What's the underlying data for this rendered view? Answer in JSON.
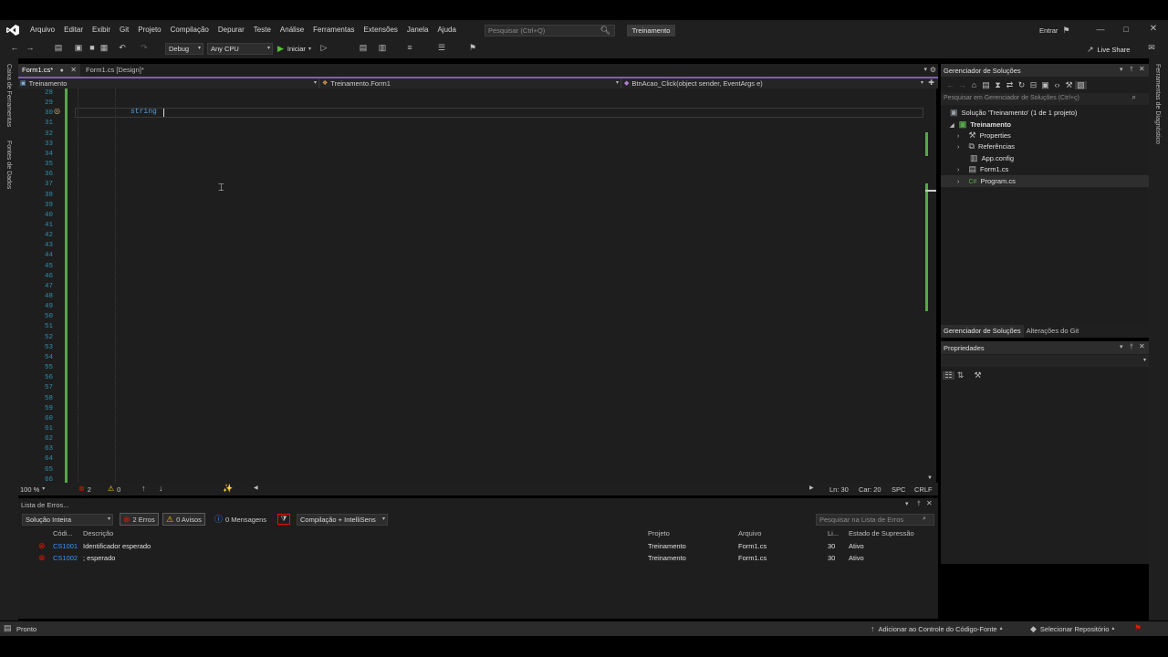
{
  "menu": {
    "items": [
      "Arquivo",
      "Editar",
      "Exibir",
      "Git",
      "Projeto",
      "Compilação",
      "Depurar",
      "Teste",
      "Análise",
      "Ferramentas",
      "Extensões",
      "Janela",
      "Ajuda"
    ],
    "search_placeholder": "Pesquisar (Ctrl+Q)",
    "solution_name": "Treinamento",
    "signin": "Entrar"
  },
  "toolbar": {
    "config": "Debug",
    "platform": "Any CPU",
    "start": "Iniciar",
    "live_share": "Live Share"
  },
  "left_strip": {
    "toolbox": "Caixa de Ferramentas",
    "data_sources": "Fontes de Dados"
  },
  "right_strip": {
    "diagnostics": "Ferramentas de Diagnóstico"
  },
  "editor": {
    "tabs": [
      "Form1.cs*",
      "Form1.cs [Design]*"
    ],
    "nav": {
      "project": "Treinamento",
      "class": "Treinamento.Form1",
      "member": "BtnAcao_Click(object sender, EventArgs e)"
    },
    "line_numbers": [
      "28",
      "29",
      "30",
      "31",
      "32",
      "33",
      "34",
      "35",
      "36",
      "37",
      "38",
      "39",
      "40",
      "41",
      "42",
      "43",
      "44",
      "45",
      "46",
      "47",
      "48",
      "49",
      "50",
      "51",
      "52",
      "53",
      "54",
      "55",
      "56",
      "57",
      "58",
      "59",
      "60",
      "61",
      "62",
      "63",
      "64",
      "65",
      "66"
    ],
    "code_text": "string ",
    "zoom": "100 %",
    "error_count": "2",
    "warning_count": "0",
    "line": "Ln: 30",
    "col": "Car: 20",
    "spacing": "SPC",
    "line_ending": "CRLF"
  },
  "error_list": {
    "title": "Lista de Erros...",
    "scope": "Solução Inteira",
    "errors_btn": "2 Erros",
    "warnings_btn": "0 Avisos",
    "messages_btn": "0 Mensagens",
    "build_filter": "Compilação + IntelliSens",
    "search_placeholder": "Pesquisar na Lista de Erros",
    "columns": {
      "code": "Códi...",
      "desc": "Descrição",
      "project": "Projeto",
      "file": "Arquivo",
      "line": "Li...",
      "suppression": "Estado de Supressão"
    },
    "rows": [
      {
        "code": "CS1001",
        "desc": "Identificador esperado",
        "project": "Treinamento",
        "file": "Form1.cs",
        "line": "30",
        "suppression": "Ativo"
      },
      {
        "code": "CS1002",
        "desc": "; esperado",
        "project": "Treinamento",
        "file": "Form1.cs",
        "line": "30",
        "suppression": "Ativo"
      }
    ]
  },
  "solution_explorer": {
    "title": "Gerenciador de Soluções",
    "search_placeholder": "Pesquisar em Gerenciador de Soluções (Ctrl+ç)",
    "solution_label": "Solução 'Treinamento' (1 de 1 projeto)",
    "project": "Treinamento",
    "items": [
      "Properties",
      "Referências",
      "App.config",
      "Form1.cs",
      "Program.cs"
    ],
    "tab_1": "Gerenciador de Soluções",
    "tab_2": "Alterações do Git"
  },
  "properties": {
    "title": "Propriedades"
  },
  "statusbar": {
    "ready": "Pronto",
    "source_control": "Adicionar ao Controle do Código-Fonte",
    "repo": "Selecionar Repositório"
  },
  "colors": {
    "accent": "#7d5cc2",
    "error": "#e51400",
    "line_number": "#2b91af",
    "change_bar": "#57a64a"
  }
}
